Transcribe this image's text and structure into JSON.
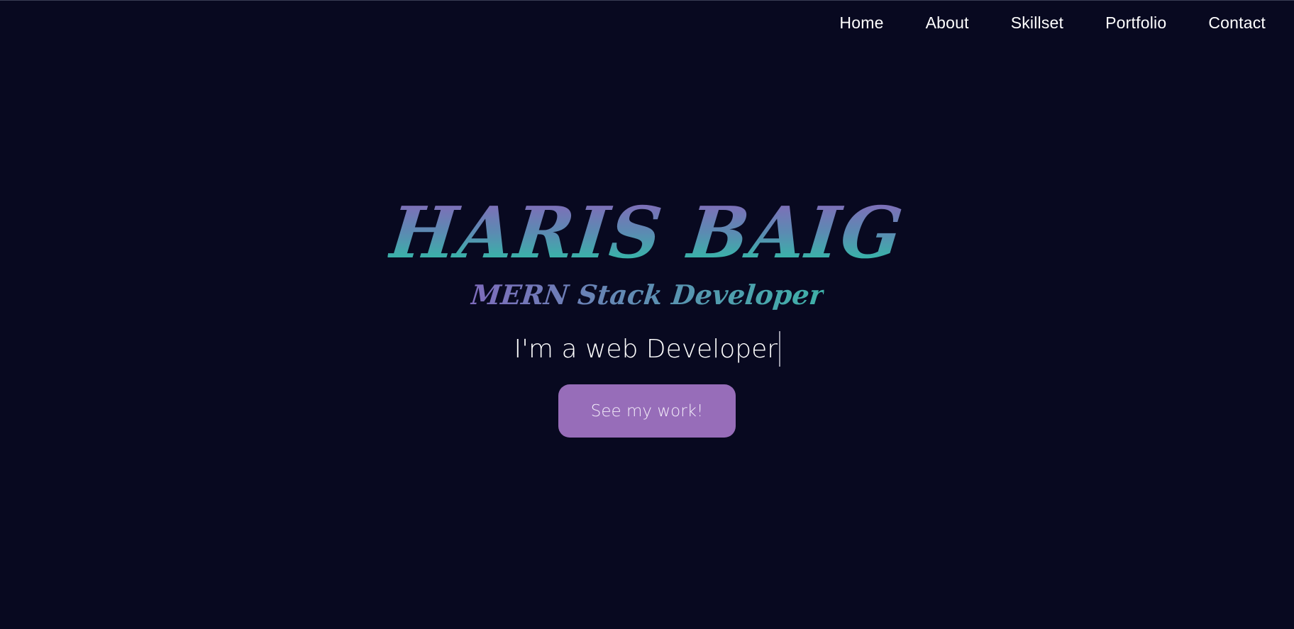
{
  "nav": {
    "items": [
      {
        "label": "Home"
      },
      {
        "label": "About"
      },
      {
        "label": "Skillset"
      },
      {
        "label": "Portfolio"
      },
      {
        "label": "Contact"
      }
    ]
  },
  "hero": {
    "name": "HARIS BAIG",
    "subtitle": "MERN Stack Developer",
    "typed_text": "I'm a web Developer",
    "cta_label": "See my work!"
  },
  "colors": {
    "background": "#080920",
    "gradient_top": "#8e62bb",
    "gradient_bottom": "#25cba3",
    "button": "#976db9"
  }
}
